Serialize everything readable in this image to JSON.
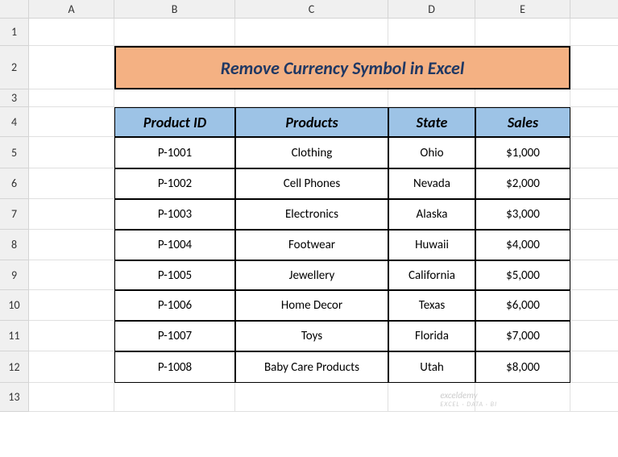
{
  "columns": [
    "A",
    "B",
    "C",
    "D",
    "E"
  ],
  "rows": [
    "1",
    "2",
    "3",
    "4",
    "5",
    "6",
    "7",
    "8",
    "9",
    "10",
    "11",
    "12",
    "13"
  ],
  "title": "Remove Currency Symbol in Excel",
  "headers": {
    "product_id": "Product ID",
    "products": "Products",
    "state": "State",
    "sales": "Sales"
  },
  "data": [
    {
      "product_id": "P-1001",
      "products": "Clothing",
      "state": "Ohio",
      "sales": "$1,000"
    },
    {
      "product_id": "P-1002",
      "products": "Cell Phones",
      "state": "Nevada",
      "sales": "$2,000"
    },
    {
      "product_id": "P-1003",
      "products": "Electronics",
      "state": "Alaska",
      "sales": "$3,000"
    },
    {
      "product_id": "P-1004",
      "products": "Footwear",
      "state": "Huwaii",
      "sales": "$4,000"
    },
    {
      "product_id": "P-1005",
      "products": "Jewellery",
      "state": "California",
      "sales": "$5,000"
    },
    {
      "product_id": "P-1006",
      "products": "Home Decor",
      "state": "Texas",
      "sales": "$6,000"
    },
    {
      "product_id": "P-1007",
      "products": "Toys",
      "state": "Florida",
      "sales": "$7,000"
    },
    {
      "product_id": "P-1008",
      "products": "Baby Care Products",
      "state": "Utah",
      "sales": "$8,000"
    }
  ],
  "watermark": {
    "line1": "exceldemy",
    "line2": "EXCEL · DATA · BI"
  }
}
